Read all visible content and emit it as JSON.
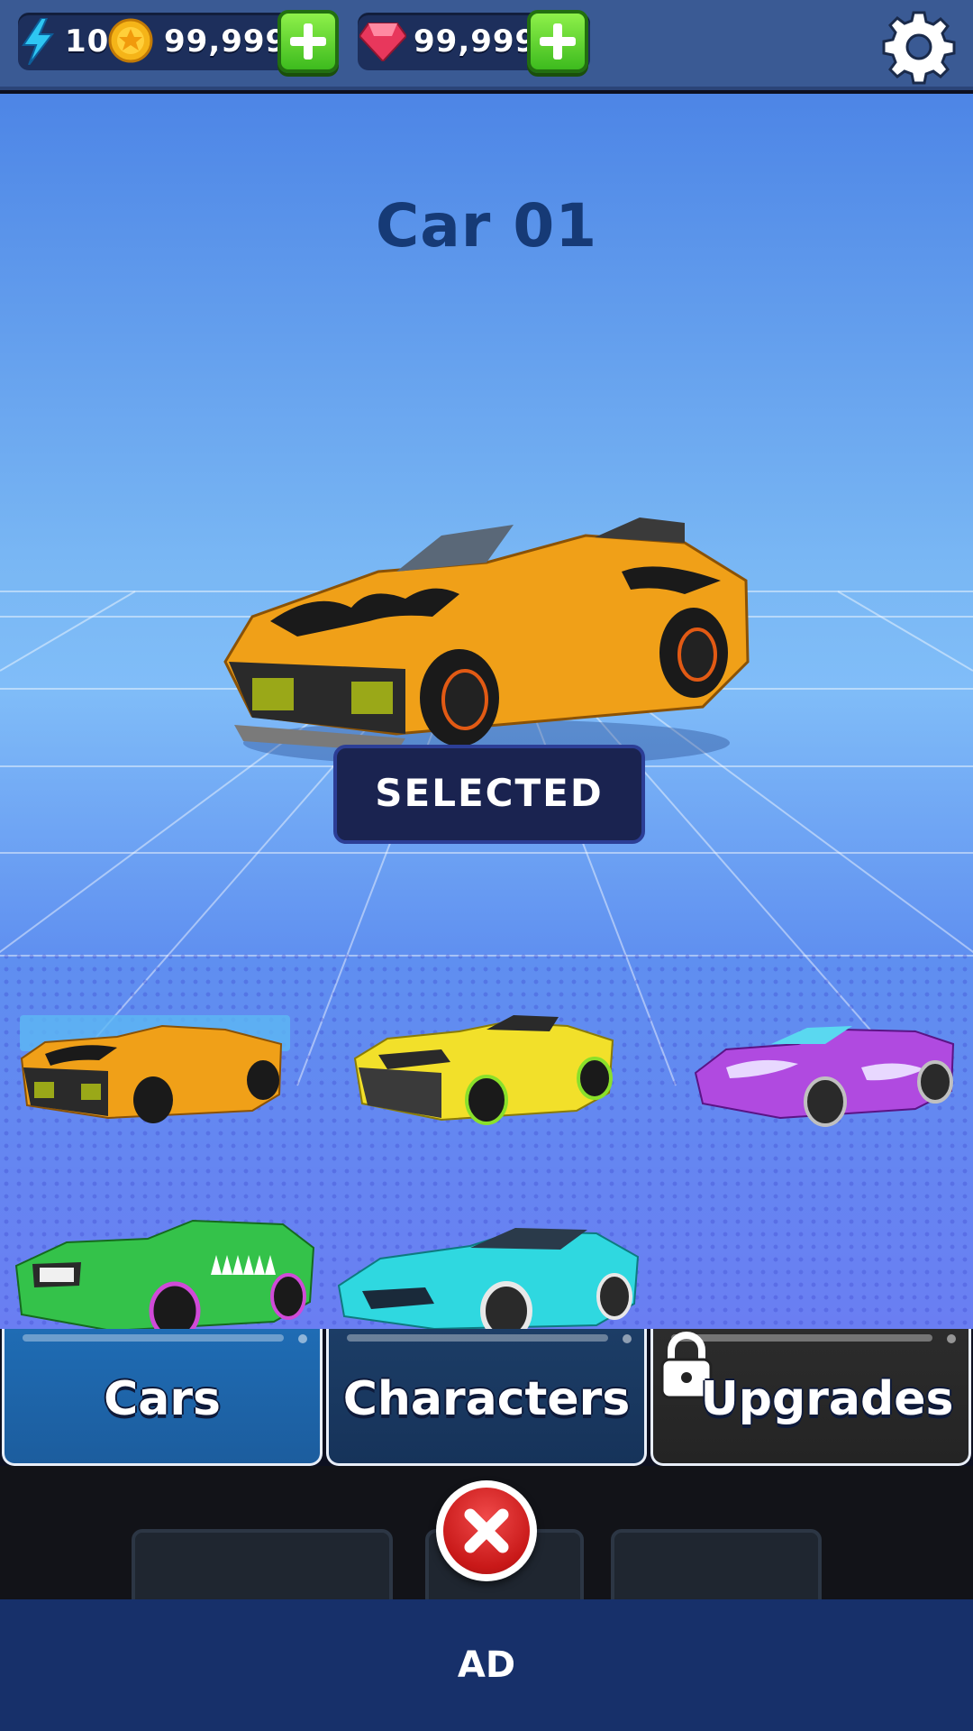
{
  "top_bar": {
    "energy": "10",
    "coins": "99,999",
    "gems": "99,999",
    "icons": [
      "lightning-icon",
      "coin-icon",
      "gem-icon",
      "plus-icon",
      "gear-icon"
    ]
  },
  "showcase": {
    "car_name": "Car 01",
    "status_button": "SELECTED",
    "cars": [
      {
        "color": "#f0a018",
        "selected": true
      },
      {
        "color": "#f2e02a",
        "selected": false
      },
      {
        "color": "#b04ae0",
        "selected": false
      },
      {
        "color": "#34c24a",
        "selected": false
      },
      {
        "color": "#2fd8e0",
        "selected": false
      }
    ]
  },
  "tabs": [
    {
      "label": "Cars",
      "active": true,
      "locked": false
    },
    {
      "label": "Characters",
      "active": false,
      "locked": false
    },
    {
      "label": "Upgrades",
      "active": false,
      "locked": true
    }
  ],
  "ad": {
    "label": "AD"
  },
  "colors": {
    "accent_green": "#3dbb1e",
    "close_red": "#c81818",
    "nav_blue": "#17306a"
  }
}
